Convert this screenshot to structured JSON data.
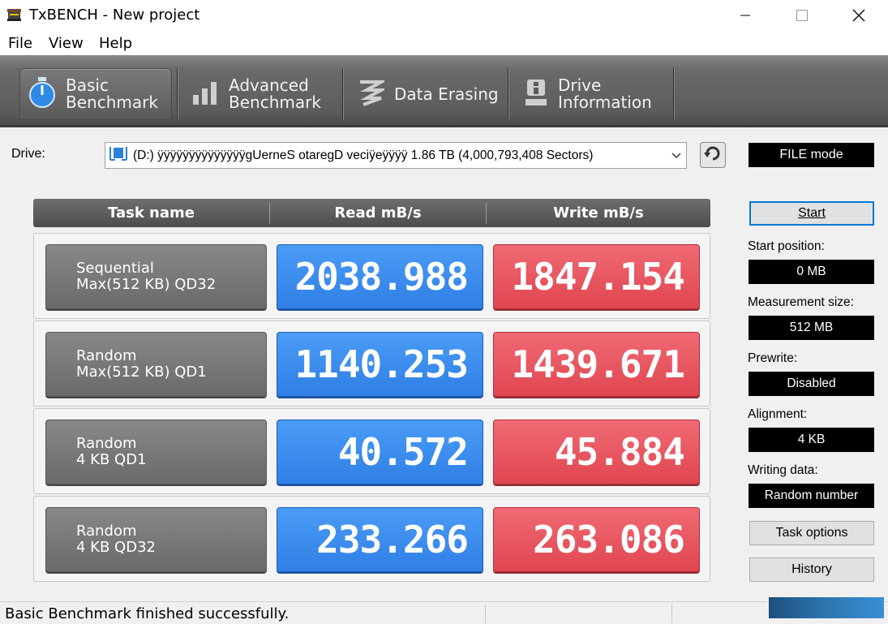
{
  "window": {
    "title": "TxBENCH - New project"
  },
  "menu": {
    "items": [
      "File",
      "View",
      "Help"
    ]
  },
  "tabs": [
    {
      "line1": "Basic",
      "line2": "Benchmark"
    },
    {
      "line1": "Advanced",
      "line2": "Benchmark"
    },
    {
      "line1": "Data Erasing",
      "line2": ""
    },
    {
      "line1": "Drive",
      "line2": "Information"
    }
  ],
  "drive": {
    "label": "Drive:",
    "value": "(D:) ÿÿÿÿÿÿÿÿÿÿÿÿÿÿgUerneS otaregD veciÿeÿÿÿÿ  1.86 TB (4,000,793,408 Sectors)",
    "mode": "FILE mode"
  },
  "table": {
    "headers": [
      "Task name",
      "Read mB/s",
      "Write mB/s"
    ],
    "rows": [
      {
        "line1": "Sequential",
        "line2": "Max(512 KB) QD32",
        "read": "2038.988",
        "write": "1847.154"
      },
      {
        "line1": "Random",
        "line2": "Max(512 KB) QD1",
        "read": "1140.253",
        "write": "1439.671"
      },
      {
        "line1": "Random",
        "line2": "4 KB QD1",
        "read": "40.572",
        "write": "45.884"
      },
      {
        "line1": "Random",
        "line2": "4 KB QD32",
        "read": "233.266",
        "write": "263.086"
      }
    ]
  },
  "panel": {
    "start_label": "Start",
    "start_position_label": "Start position:",
    "start_position_value": "0 MB",
    "measurement_size_label": "Measurement size:",
    "measurement_size_value": "512 MB",
    "prewrite_label": "Prewrite:",
    "prewrite_value": "Disabled",
    "alignment_label": "Alignment:",
    "alignment_value": "4 KB",
    "writing_data_label": "Writing data:",
    "writing_data_value": "Random number",
    "task_options_label": "Task options",
    "history_label": "History"
  },
  "status": {
    "message": "Basic Benchmark finished successfully."
  },
  "colors": {
    "read": "#3d8ff0",
    "write": "#e9535d",
    "toolbar": "#5e5e5e"
  }
}
